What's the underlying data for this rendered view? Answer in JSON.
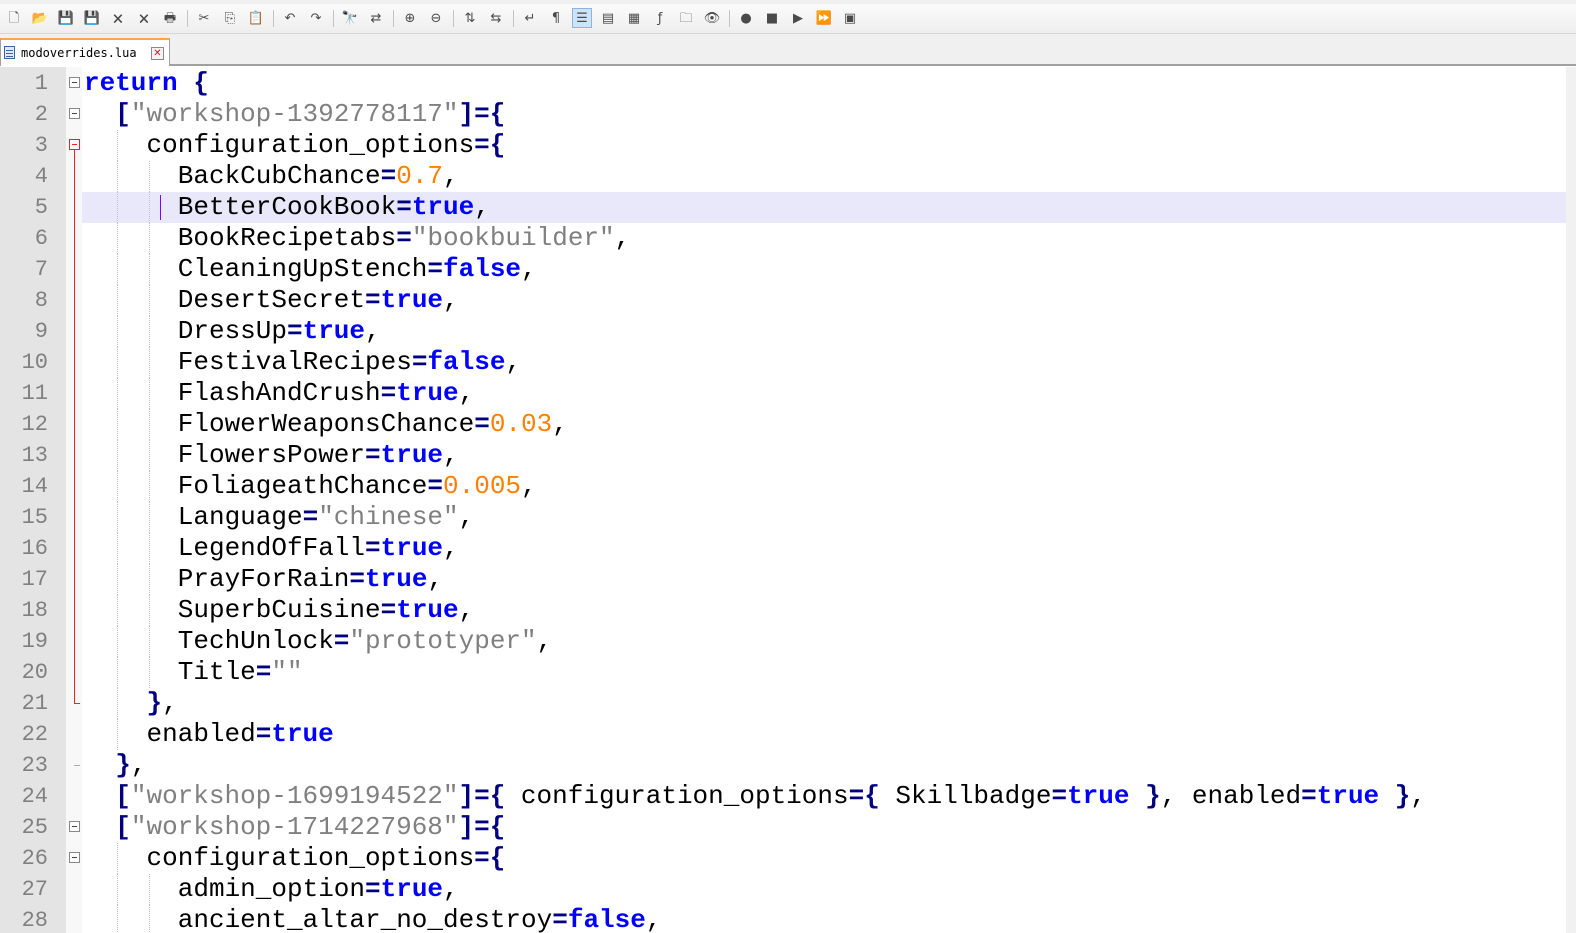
{
  "toolbar": {
    "groups": [
      [
        {
          "name": "new-file-icon",
          "glyph": "🗋"
        },
        {
          "name": "open-file-icon",
          "glyph": "📂"
        },
        {
          "name": "save-icon",
          "glyph": "💾"
        },
        {
          "name": "save-all-icon",
          "glyph": "💾"
        },
        {
          "name": "close-icon",
          "glyph": "🗙"
        },
        {
          "name": "close-all-icon",
          "glyph": "🗙"
        },
        {
          "name": "print-icon",
          "glyph": "🖶"
        }
      ],
      [
        {
          "name": "cut-icon",
          "glyph": "✂"
        },
        {
          "name": "copy-icon",
          "glyph": "⎘"
        },
        {
          "name": "paste-icon",
          "glyph": "📋"
        }
      ],
      [
        {
          "name": "undo-icon",
          "glyph": "↶"
        },
        {
          "name": "redo-icon",
          "glyph": "↷"
        }
      ],
      [
        {
          "name": "find-icon",
          "glyph": "🔭"
        },
        {
          "name": "replace-icon",
          "glyph": "⇄"
        }
      ],
      [
        {
          "name": "zoom-in-icon",
          "glyph": "⊕"
        },
        {
          "name": "zoom-out-icon",
          "glyph": "⊖"
        }
      ],
      [
        {
          "name": "sync-vertical-icon",
          "glyph": "⇅"
        },
        {
          "name": "sync-horizontal-icon",
          "glyph": "⇆"
        }
      ],
      [
        {
          "name": "word-wrap-icon",
          "glyph": "↵"
        },
        {
          "name": "show-all-characters-icon",
          "glyph": "¶"
        },
        {
          "name": "indent-guide-icon",
          "glyph": "☰",
          "active": true
        },
        {
          "name": "language-udl-icon",
          "glyph": "▤"
        },
        {
          "name": "document-map-icon",
          "glyph": "▦"
        },
        {
          "name": "function-list-icon",
          "glyph": "ƒ"
        },
        {
          "name": "folder-workspace-icon",
          "glyph": "🗀"
        },
        {
          "name": "monitoring-icon",
          "glyph": "👁"
        }
      ],
      [
        {
          "name": "record-macro-icon",
          "glyph": "●"
        },
        {
          "name": "stop-recording-icon",
          "glyph": "■"
        },
        {
          "name": "playback-macro-icon",
          "glyph": "▶"
        },
        {
          "name": "run-macro-multiple-icon",
          "glyph": "⏩"
        },
        {
          "name": "save-macro-icon",
          "glyph": "▣"
        }
      ]
    ]
  },
  "tab": {
    "label": "modoverrides.lua",
    "close_glyph": "✕"
  },
  "editor": {
    "current_line": 5,
    "lines": [
      {
        "n": "1",
        "indent": 0,
        "tokens": [
          [
            "kw",
            "return"
          ],
          [
            "id",
            " "
          ],
          [
            "op",
            "{"
          ]
        ]
      },
      {
        "n": "2",
        "indent": 1,
        "tokens": [
          [
            "op",
            "["
          ],
          [
            "str",
            "\"workshop-1392778117\""
          ],
          [
            "op",
            "]={"
          ]
        ]
      },
      {
        "n": "3",
        "indent": 2,
        "tokens": [
          [
            "id",
            "configuration_options"
          ],
          [
            "op",
            "={"
          ]
        ]
      },
      {
        "n": "4",
        "indent": 3,
        "tokens": [
          [
            "id",
            "BackCubChance"
          ],
          [
            "op",
            "="
          ],
          [
            "num",
            "0.7"
          ],
          [
            "id",
            ","
          ]
        ]
      },
      {
        "n": "5",
        "indent": 3,
        "tokens": [
          [
            "id",
            "BetterCookBook"
          ],
          [
            "op",
            "="
          ],
          [
            "kw",
            "true"
          ],
          [
            "id",
            ","
          ]
        ]
      },
      {
        "n": "6",
        "indent": 3,
        "tokens": [
          [
            "id",
            "BookRecipetabs"
          ],
          [
            "op",
            "="
          ],
          [
            "str",
            "\"bookbuilder\""
          ],
          [
            "id",
            ","
          ]
        ]
      },
      {
        "n": "7",
        "indent": 3,
        "tokens": [
          [
            "id",
            "CleaningUpStench"
          ],
          [
            "op",
            "="
          ],
          [
            "kw",
            "false"
          ],
          [
            "id",
            ","
          ]
        ]
      },
      {
        "n": "8",
        "indent": 3,
        "tokens": [
          [
            "id",
            "DesertSecret"
          ],
          [
            "op",
            "="
          ],
          [
            "kw",
            "true"
          ],
          [
            "id",
            ","
          ]
        ]
      },
      {
        "n": "9",
        "indent": 3,
        "tokens": [
          [
            "id",
            "DressUp"
          ],
          [
            "op",
            "="
          ],
          [
            "kw",
            "true"
          ],
          [
            "id",
            ","
          ]
        ]
      },
      {
        "n": "10",
        "indent": 3,
        "tokens": [
          [
            "id",
            "FestivalRecipes"
          ],
          [
            "op",
            "="
          ],
          [
            "kw",
            "false"
          ],
          [
            "id",
            ","
          ]
        ]
      },
      {
        "n": "11",
        "indent": 3,
        "tokens": [
          [
            "id",
            "FlashAndCrush"
          ],
          [
            "op",
            "="
          ],
          [
            "kw",
            "true"
          ],
          [
            "id",
            ","
          ]
        ]
      },
      {
        "n": "12",
        "indent": 3,
        "tokens": [
          [
            "id",
            "FlowerWeaponsChance"
          ],
          [
            "op",
            "="
          ],
          [
            "num",
            "0.03"
          ],
          [
            "id",
            ","
          ]
        ]
      },
      {
        "n": "13",
        "indent": 3,
        "tokens": [
          [
            "id",
            "FlowersPower"
          ],
          [
            "op",
            "="
          ],
          [
            "kw",
            "true"
          ],
          [
            "id",
            ","
          ]
        ]
      },
      {
        "n": "14",
        "indent": 3,
        "tokens": [
          [
            "id",
            "FoliageathChance"
          ],
          [
            "op",
            "="
          ],
          [
            "num",
            "0.005"
          ],
          [
            "id",
            ","
          ]
        ]
      },
      {
        "n": "15",
        "indent": 3,
        "tokens": [
          [
            "id",
            "Language"
          ],
          [
            "op",
            "="
          ],
          [
            "str",
            "\"chinese\""
          ],
          [
            "id",
            ","
          ]
        ]
      },
      {
        "n": "16",
        "indent": 3,
        "tokens": [
          [
            "id",
            "LegendOfFall"
          ],
          [
            "op",
            "="
          ],
          [
            "kw",
            "true"
          ],
          [
            "id",
            ","
          ]
        ]
      },
      {
        "n": "17",
        "indent": 3,
        "tokens": [
          [
            "id",
            "PrayForRain"
          ],
          [
            "op",
            "="
          ],
          [
            "kw",
            "true"
          ],
          [
            "id",
            ","
          ]
        ]
      },
      {
        "n": "18",
        "indent": 3,
        "tokens": [
          [
            "id",
            "SuperbCuisine"
          ],
          [
            "op",
            "="
          ],
          [
            "kw",
            "true"
          ],
          [
            "id",
            ","
          ]
        ]
      },
      {
        "n": "19",
        "indent": 3,
        "tokens": [
          [
            "id",
            "TechUnlock"
          ],
          [
            "op",
            "="
          ],
          [
            "str",
            "\"prototyper\""
          ],
          [
            "id",
            ","
          ]
        ]
      },
      {
        "n": "20",
        "indent": 3,
        "tokens": [
          [
            "id",
            "Title"
          ],
          [
            "op",
            "="
          ],
          [
            "str",
            "\"\""
          ]
        ]
      },
      {
        "n": "21",
        "indent": 2,
        "tokens": [
          [
            "op",
            "}"
          ],
          [
            "id",
            ","
          ]
        ]
      },
      {
        "n": "22",
        "indent": 2,
        "tokens": [
          [
            "id",
            "enabled"
          ],
          [
            "op",
            "="
          ],
          [
            "kw",
            "true"
          ]
        ]
      },
      {
        "n": "23",
        "indent": 1,
        "tokens": [
          [
            "op",
            "}"
          ],
          [
            "id",
            ","
          ]
        ]
      },
      {
        "n": "24",
        "indent": 1,
        "tokens": [
          [
            "op",
            "["
          ],
          [
            "str",
            "\"workshop-1699194522\""
          ],
          [
            "op",
            "]={"
          ],
          [
            "id",
            " configuration_options"
          ],
          [
            "op",
            "={"
          ],
          [
            "id",
            " Skillbadge"
          ],
          [
            "op",
            "="
          ],
          [
            "kw",
            "true"
          ],
          [
            "id",
            " "
          ],
          [
            "op",
            "}"
          ],
          [
            "id",
            ", enabled"
          ],
          [
            "op",
            "="
          ],
          [
            "kw",
            "true"
          ],
          [
            "id",
            " "
          ],
          [
            "op",
            "}"
          ],
          [
            "id",
            ","
          ]
        ]
      },
      {
        "n": "25",
        "indent": 1,
        "tokens": [
          [
            "op",
            "["
          ],
          [
            "str",
            "\"workshop-1714227968\""
          ],
          [
            "op",
            "]={"
          ]
        ]
      },
      {
        "n": "26",
        "indent": 2,
        "tokens": [
          [
            "id",
            "configuration_options"
          ],
          [
            "op",
            "={"
          ]
        ]
      },
      {
        "n": "27",
        "indent": 3,
        "tokens": [
          [
            "id",
            "admin_option"
          ],
          [
            "op",
            "="
          ],
          [
            "kw",
            "true"
          ],
          [
            "id",
            ","
          ]
        ]
      },
      {
        "n": "28",
        "indent": 3,
        "tokens": [
          [
            "id",
            "ancient_altar_no_destroy"
          ],
          [
            "op",
            "="
          ],
          [
            "kw",
            "false"
          ],
          [
            "id",
            ","
          ]
        ]
      }
    ]
  }
}
